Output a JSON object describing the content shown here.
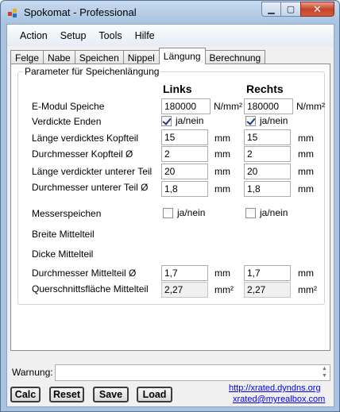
{
  "window": {
    "title": "Spokomat - Professional"
  },
  "menu": [
    "Action",
    "Setup",
    "Tools",
    "Hilfe"
  ],
  "tabs": [
    "Felge",
    "Nabe",
    "Speichen",
    "Nippel",
    "Längung",
    "Berechnung"
  ],
  "active_tab": "Längung",
  "group": {
    "title": "Parameter für Speichenlängung",
    "col_left": "Links",
    "col_right": "Rechts",
    "rows": {
      "emodul": {
        "label": "E-Modul Speiche",
        "left": "180000",
        "right": "180000",
        "unit": "N/mm²"
      },
      "verdickt": {
        "label": "Verdickte Enden",
        "left_checked": true,
        "right_checked": true,
        "check_label": "ja/nein"
      },
      "laenge_kopf": {
        "label": "Länge verdicktes Kopfteil",
        "left": "15",
        "right": "15",
        "unit": "mm"
      },
      "dm_kopf": {
        "label": "Durchmesser Kopfteil Ø",
        "left": "2",
        "right": "2",
        "unit": "mm"
      },
      "laenge_unten": {
        "label": "Länge verdickter unterer Teil",
        "left": "20",
        "right": "20",
        "unit": "mm"
      },
      "dm_unten": {
        "label": "Durchmesser unterer Teil Ø",
        "left": "1,8",
        "right": "1,8",
        "unit": "mm"
      },
      "messer": {
        "label": "Messerspeichen",
        "left_checked": false,
        "right_checked": false,
        "check_label": "ja/nein"
      },
      "breite": {
        "label": "Breite Mittelteil"
      },
      "dicke": {
        "label": "Dicke Mittelteil"
      },
      "dm_mitte": {
        "label": "Durchmesser Mittelteil Ø",
        "left": "1,7",
        "right": "1,7",
        "unit": "mm"
      },
      "querschnitt": {
        "label": "Querschnittsfläche Mittelteil",
        "left": "2,27",
        "right": "2,27",
        "unit": "mm²"
      }
    }
  },
  "footer": {
    "warning_label": "Warnung:",
    "warning_value": "",
    "buttons": {
      "calc": "Calc",
      "reset": "Reset",
      "save": "Save",
      "load": "Load"
    },
    "links": {
      "url": "http://xrated.dyndns.org",
      "email": "xrated@myrealbox.com"
    }
  },
  "colors": {
    "titlebar": "#a7c2e0",
    "close_button": "#c8432a",
    "link": "#0000ee"
  }
}
